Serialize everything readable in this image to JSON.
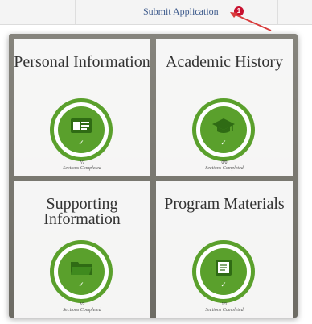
{
  "header": {
    "submit_label": "Submit Application",
    "badge_count": "1"
  },
  "colors": {
    "accent_green": "#5aa02c",
    "badge_red": "#c8102e",
    "link_blue": "#3d5a8c"
  },
  "cards": [
    {
      "title": "Personal Information",
      "count": "7/7",
      "status": "Sections Completed",
      "icon": "id-card-icon"
    },
    {
      "title": "Academic History",
      "count": "0/0",
      "status": "Sections Completed",
      "icon": "graduation-cap-icon"
    },
    {
      "title": "Supporting Information",
      "count": "2/2",
      "status": "Sections Completed",
      "icon": "folder-icon"
    },
    {
      "title": "Program Materials",
      "count": "1/1",
      "status": "Sections Completed",
      "icon": "book-icon"
    }
  ]
}
